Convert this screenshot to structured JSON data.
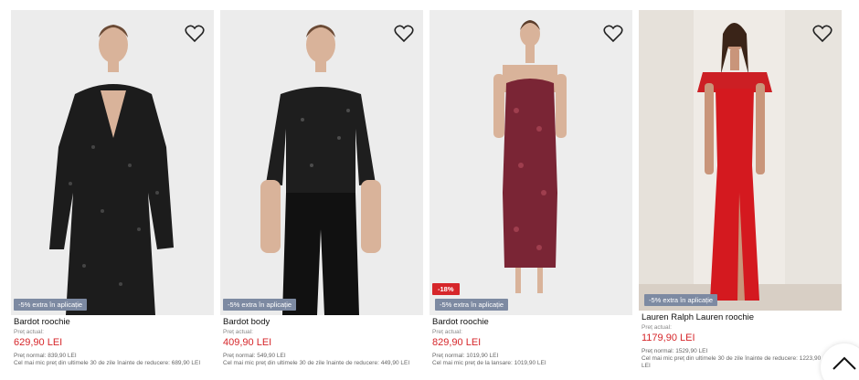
{
  "products": [
    {
      "name": "Bardot roochie",
      "current_label": "Preț actual:",
      "price": "629,90 LEI",
      "normal_price": "Preț normal: 839,90 LEI",
      "lowest_price": "Cel mai mic preț din ultimele 30 de zile înainte de reducere: 689,90 LEI",
      "promo_badge": "-5% extra în aplicație",
      "discount_badge": null,
      "favorite_icon": "heart-outline-icon"
    },
    {
      "name": "Bardot body",
      "current_label": "Preț actual:",
      "price": "409,90 LEI",
      "normal_price": "Preț normal: 549,90 LEI",
      "lowest_price": "Cel mai mic preț din ultimele 30 de zile înainte de reducere: 449,90 LEI",
      "promo_badge": "-5% extra în aplicație",
      "discount_badge": null,
      "favorite_icon": "heart-outline-icon"
    },
    {
      "name": "Bardot roochie",
      "current_label": "Preț actual:",
      "price": "829,90 LEI",
      "normal_price": "Preț normal: 1019,90 LEI",
      "lowest_price": "Cel mai mic preț de la lansare: 1019,90 LEI",
      "promo_badge": "-5% extra în aplicație",
      "discount_badge": "-18%",
      "favorite_icon": "heart-outline-icon"
    },
    {
      "name": "Lauren Ralph Lauren roochie",
      "current_label": "Preț actual:",
      "price": "1179,90 LEI",
      "normal_price": "Preț normal: 1529,90 LEI",
      "lowest_price": "Cel mai mic preț din ultimele 30 de zile înainte de reducere: 1223,90 LEI",
      "promo_badge": "-5% extra în aplicație",
      "discount_badge": null,
      "favorite_icon": "heart-outline-icon"
    }
  ],
  "scroll_top_icon": "chevron-up-icon",
  "colors": {
    "price_red": "#d6262a",
    "promo_badge_bg": "#7d8aa2",
    "discount_badge_bg": "#d6262a"
  }
}
